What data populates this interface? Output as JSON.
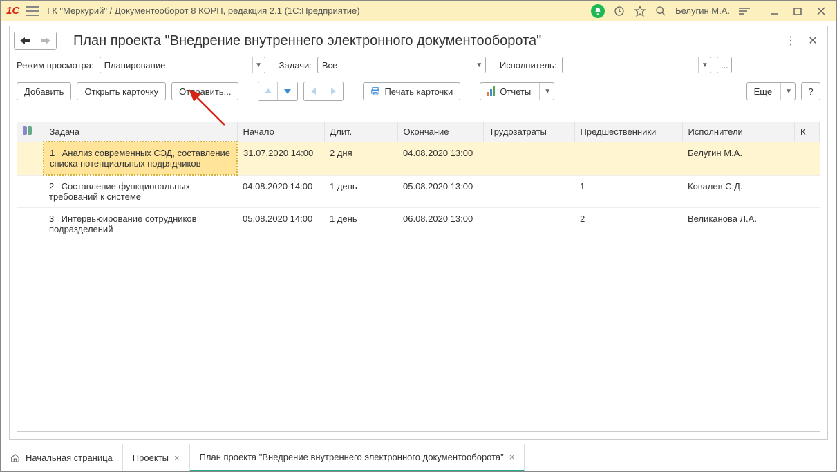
{
  "titlebar": {
    "app_title": "ГК \"Меркурий\" / Документооборот 8 КОРП, редакция 2.1  (1С:Предприятие)",
    "username": "Белугин М.А."
  },
  "page": {
    "title": "План проекта \"Внедрение внутреннего электронного документооборота\""
  },
  "filters": {
    "view_mode_label": "Режим просмотра:",
    "view_mode_value": "Планирование",
    "tasks_label": "Задачи:",
    "tasks_value": "Все",
    "executor_label": "Исполнитель:",
    "executor_value": ""
  },
  "toolbar": {
    "add": "Добавить",
    "open_card": "Открыть карточку",
    "send": "Отправить...",
    "print_card": "Печать карточки",
    "reports": "Отчеты",
    "more": "Еще",
    "help": "?"
  },
  "table": {
    "headers": {
      "task": "Задача",
      "start": "Начало",
      "duration": "Длит.",
      "end": "Окончание",
      "effort": "Трудозатраты",
      "predecessors": "Предшественники",
      "executors": "Исполнители",
      "k": "К"
    },
    "rows": [
      {
        "num": "1",
        "task": "Анализ современных СЭД, составление списка потенциальных подрядчиков",
        "start": "31.07.2020 14:00",
        "duration": "2 дня",
        "end": "04.08.2020 13:00",
        "effort": "",
        "predecessors": "",
        "executors": "Белугин М.А.",
        "selected": true
      },
      {
        "num": "2",
        "task": "Составление функциональных требований к системе",
        "start": "04.08.2020 14:00",
        "duration": "1 день",
        "end": "05.08.2020 13:00",
        "effort": "",
        "predecessors": "1",
        "executors": "Ковалев С.Д.",
        "selected": false
      },
      {
        "num": "3",
        "task": "Интервьюирование сотрудников подразделений",
        "start": "05.08.2020 14:00",
        "duration": "1 день",
        "end": "06.08.2020 13:00",
        "effort": "",
        "predecessors": "2",
        "executors": "Великанова Л.А.",
        "selected": false
      }
    ]
  },
  "tabs": {
    "home": "Начальная страница",
    "projects": "Проекты",
    "plan": "План проекта \"Внедрение внутреннего электронного документооборота\""
  }
}
